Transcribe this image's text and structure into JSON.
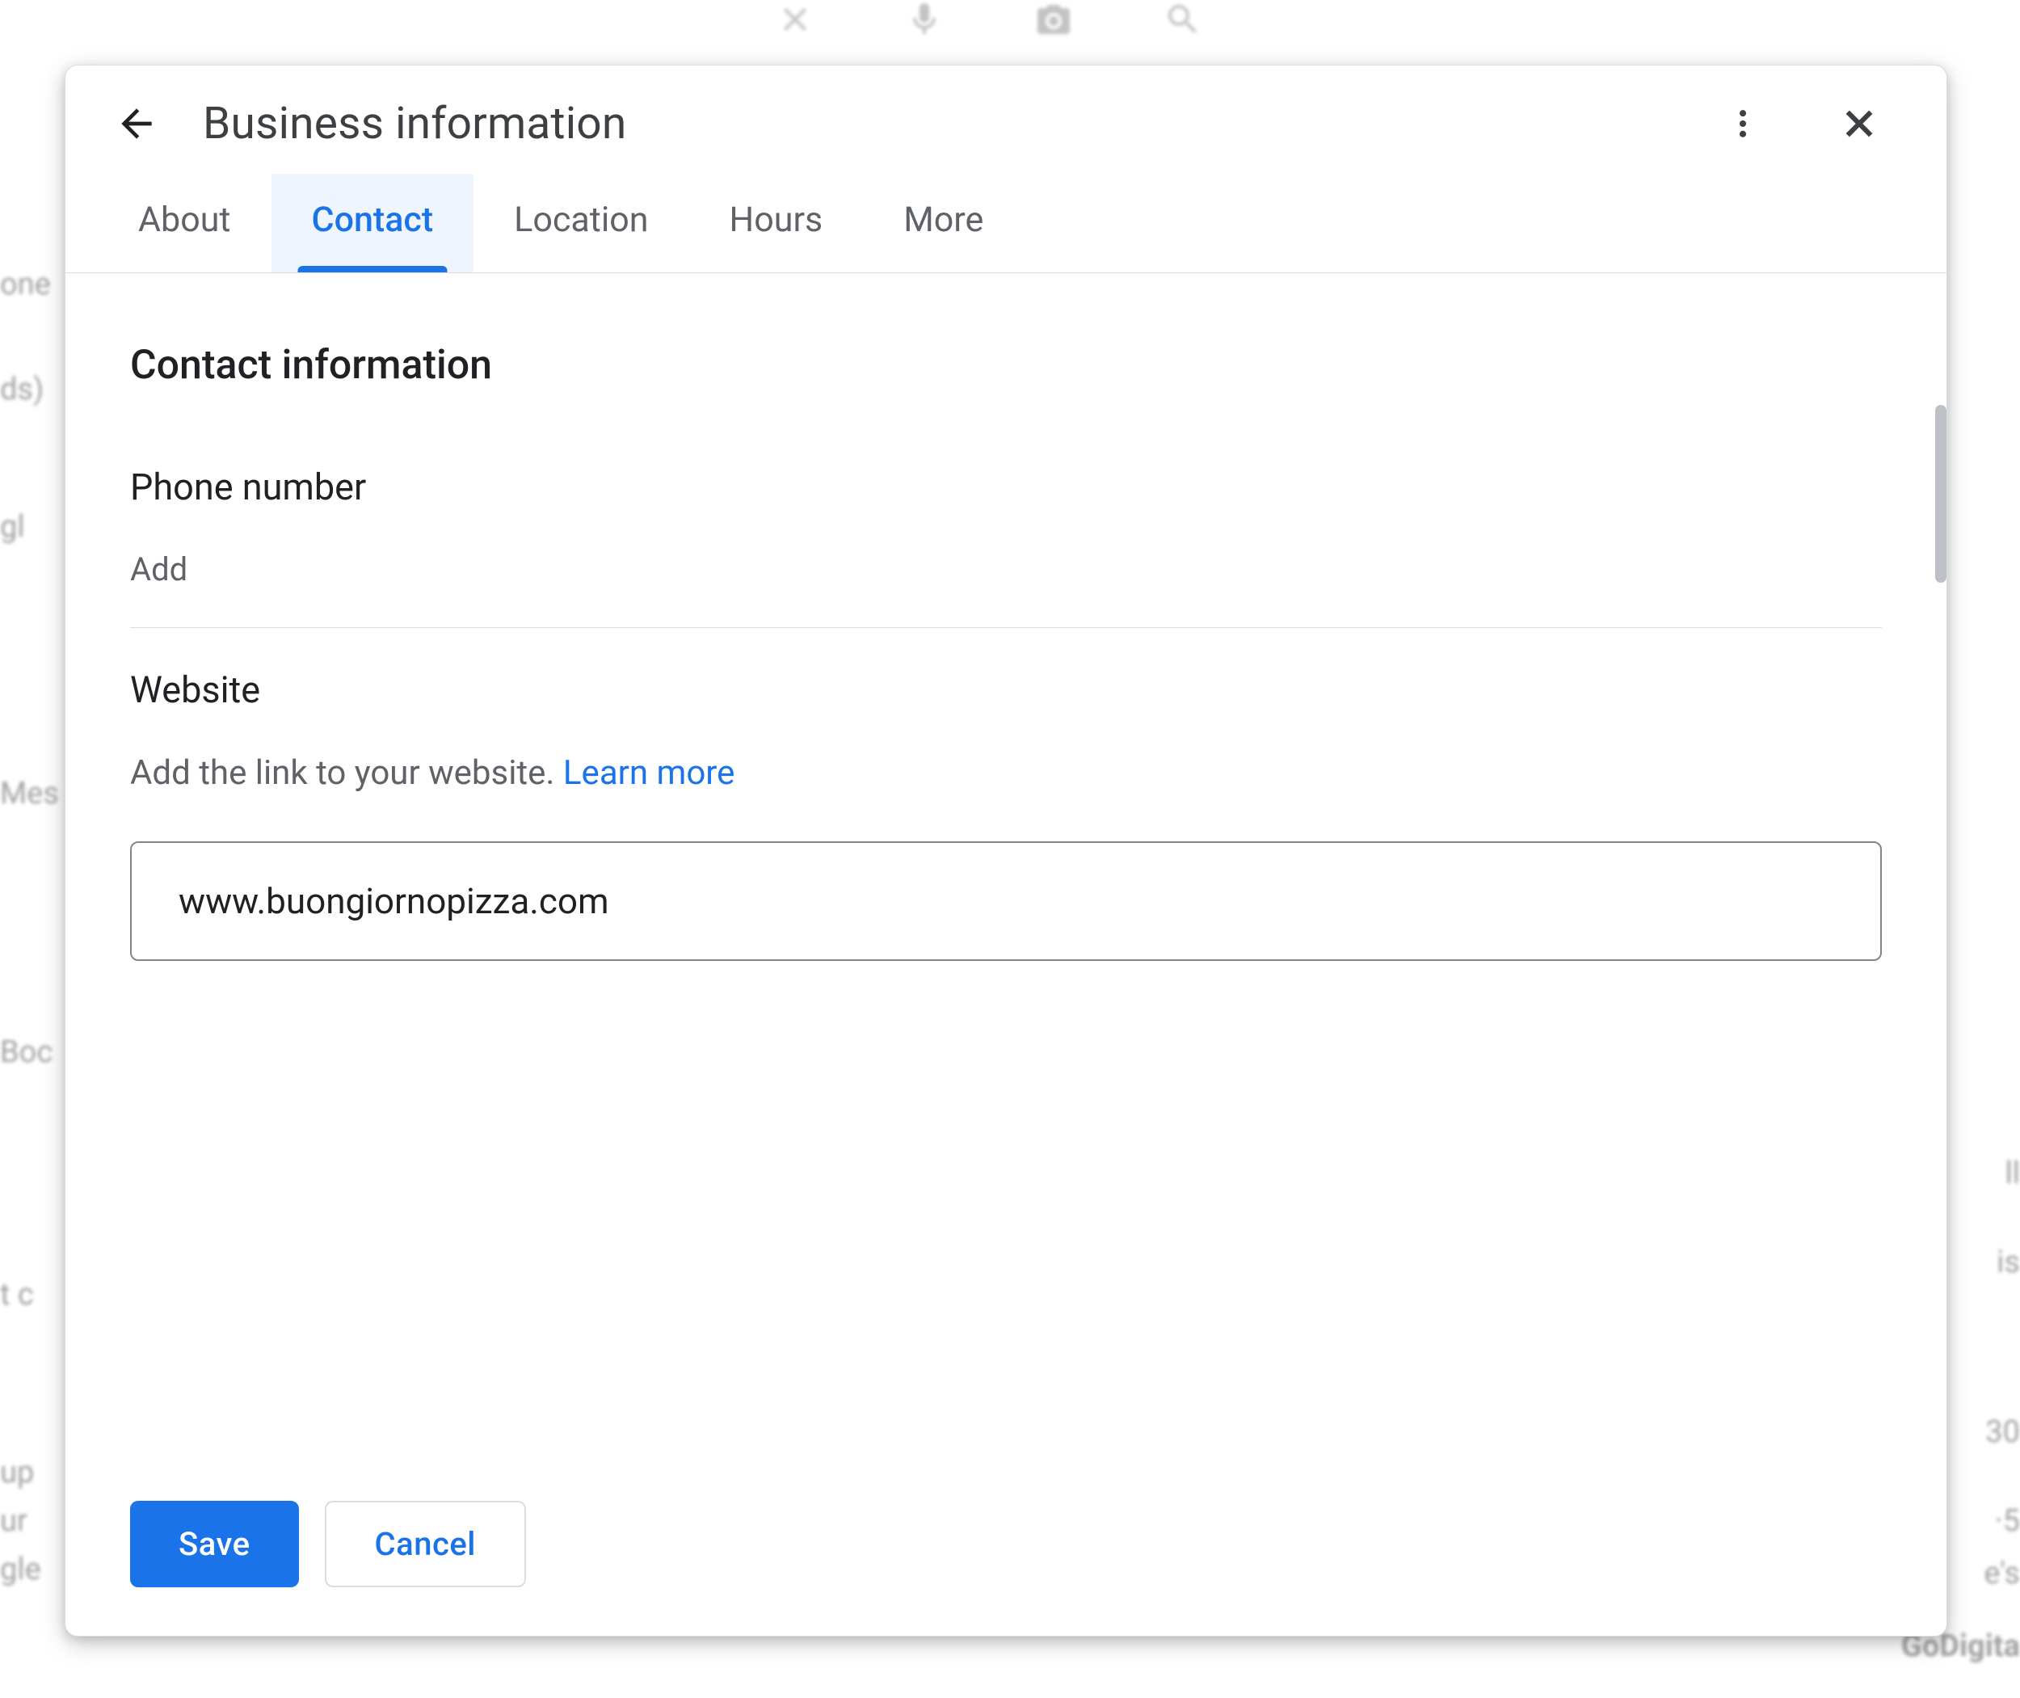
{
  "background": {
    "left_fragments": [
      "one",
      "ds)",
      "gl",
      "Mes",
      "Boc",
      "t c",
      "up",
      "ur",
      "gle"
    ],
    "right_fragments": [
      "ll",
      "is",
      "30",
      "·5",
      "e's",
      "GoDigita"
    ]
  },
  "modal": {
    "title": "Business information",
    "tabs": [
      {
        "label": "About",
        "active": false
      },
      {
        "label": "Contact",
        "active": true
      },
      {
        "label": "Location",
        "active": false
      },
      {
        "label": "Hours",
        "active": false
      },
      {
        "label": "More",
        "active": false
      }
    ],
    "section_title": "Contact information",
    "phone": {
      "label": "Phone number",
      "add_text": "Add"
    },
    "website": {
      "label": "Website",
      "description": "Add the link to your website.",
      "learn_more": "Learn more",
      "input_value": "www.buongiornopizza.com"
    },
    "footer": {
      "save": "Save",
      "cancel": "Cancel"
    }
  }
}
